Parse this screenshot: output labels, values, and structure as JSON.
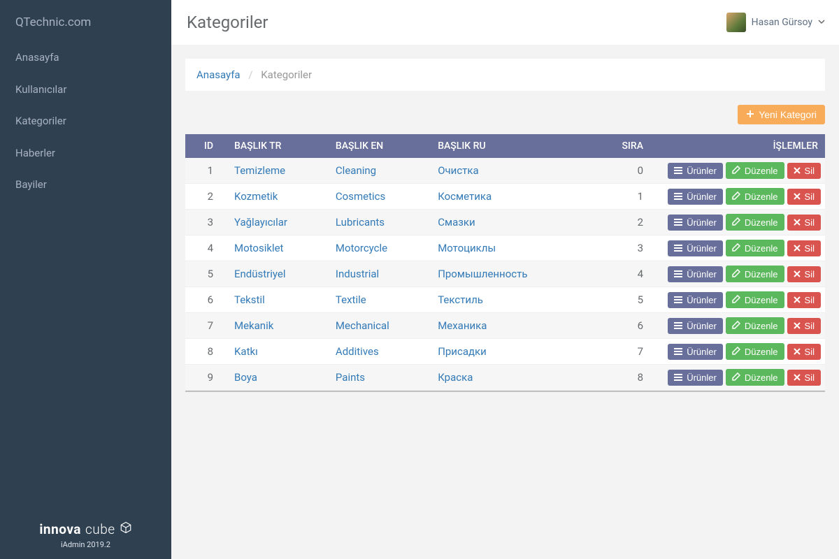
{
  "brand": "QTechnic.com",
  "sidebar": {
    "items": [
      {
        "label": "Anasayfa"
      },
      {
        "label": "Kullanıcılar"
      },
      {
        "label": "Kategoriler"
      },
      {
        "label": "Haberler"
      },
      {
        "label": "Bayiler"
      }
    ],
    "footer": {
      "logo_bold": "innova",
      "logo_light": "cube",
      "version": "iAdmin 2019.2"
    }
  },
  "header": {
    "title": "Kategoriler",
    "user_name": "Hasan Gürsoy"
  },
  "breadcrumb": {
    "home": "Anasayfa",
    "current": "Kategoriler"
  },
  "buttons": {
    "new_category": "Yeni Kategori",
    "products": "Ürünler",
    "edit": "Düzenle",
    "delete": "Sil"
  },
  "table": {
    "columns": {
      "id": "ID",
      "title_tr": "BAŞLIK TR",
      "title_en": "BAŞLIK EN",
      "title_ru": "BAŞLIK RU",
      "order": "SIRA",
      "actions": "İŞLEMLER"
    },
    "rows": [
      {
        "id": "1",
        "tr": "Temizleme",
        "en": "Cleaning",
        "ru": "Очистка",
        "order": "0"
      },
      {
        "id": "2",
        "tr": "Kozmetik",
        "en": "Cosmetics",
        "ru": "Косметика",
        "order": "1"
      },
      {
        "id": "3",
        "tr": "Yağlayıcılar",
        "en": "Lubricants",
        "ru": "Смазки",
        "order": "2"
      },
      {
        "id": "4",
        "tr": "Motosiklet",
        "en": "Motorcycle",
        "ru": "Мотоциклы",
        "order": "3"
      },
      {
        "id": "5",
        "tr": "Endüstriyel",
        "en": "Industrial",
        "ru": "Промышленность",
        "order": "4"
      },
      {
        "id": "6",
        "tr": "Tekstil",
        "en": "Textile",
        "ru": "Текстиль",
        "order": "5"
      },
      {
        "id": "7",
        "tr": "Mekanik",
        "en": "Mechanical",
        "ru": "Механика",
        "order": "6"
      },
      {
        "id": "8",
        "tr": "Katkı",
        "en": "Additives",
        "ru": "Присадки",
        "order": "7"
      },
      {
        "id": "9",
        "tr": "Boya",
        "en": "Paints",
        "ru": "Краска",
        "order": "8"
      }
    ]
  }
}
